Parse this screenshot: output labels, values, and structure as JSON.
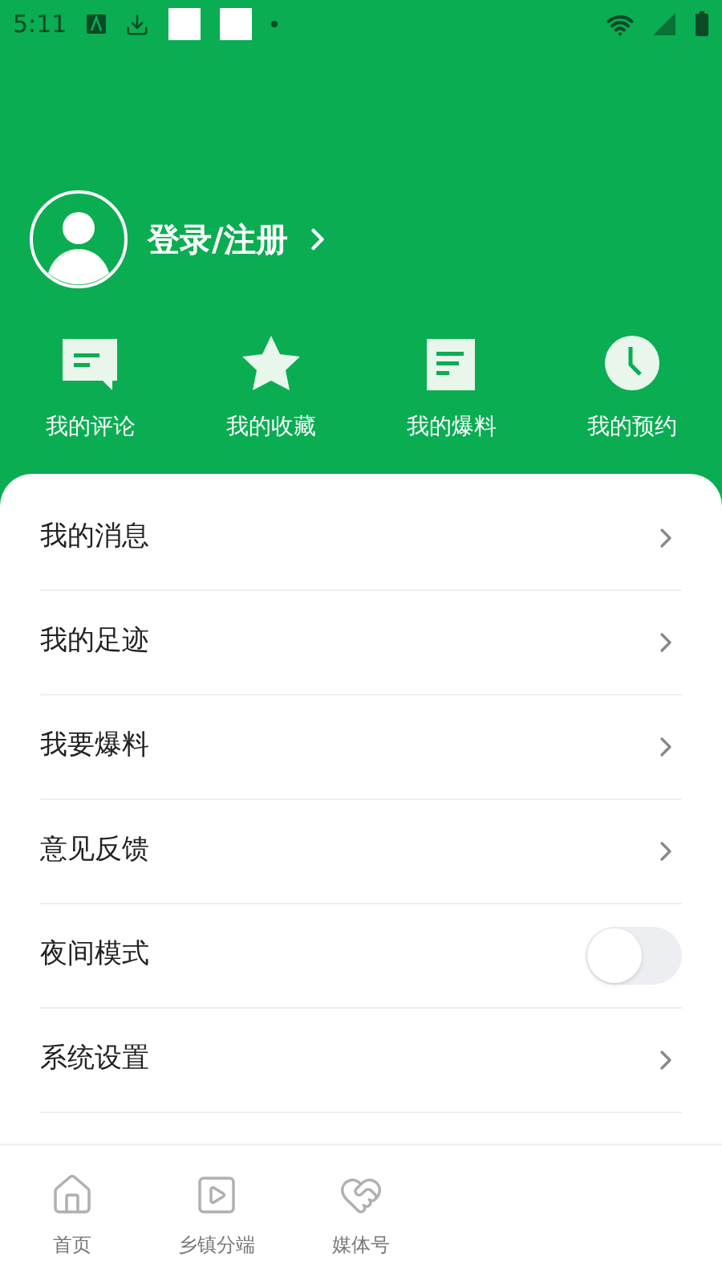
{
  "status_bar": {
    "time": "5:11"
  },
  "profile": {
    "login_label": "登录/注册"
  },
  "shortcuts": [
    {
      "kind": "comment",
      "label": "我的评论"
    },
    {
      "kind": "favorite",
      "label": "我的收藏"
    },
    {
      "kind": "report",
      "label": "我的爆料"
    },
    {
      "kind": "booking",
      "label": "我的预约"
    }
  ],
  "menu": [
    {
      "kind": "link",
      "label": "我的消息"
    },
    {
      "kind": "link",
      "label": "我的足迹"
    },
    {
      "kind": "link",
      "label": "我要爆料"
    },
    {
      "kind": "link",
      "label": "意见反馈"
    },
    {
      "kind": "toggle",
      "label": "夜间模式",
      "on": false
    },
    {
      "kind": "link",
      "label": "系统设置"
    }
  ],
  "bottom_nav": [
    {
      "kind": "home",
      "label": "首页",
      "selected": false
    },
    {
      "kind": "video",
      "label": "乡镇分端",
      "selected": false
    },
    {
      "kind": "heart",
      "label": "媒体号",
      "selected": false
    }
  ]
}
